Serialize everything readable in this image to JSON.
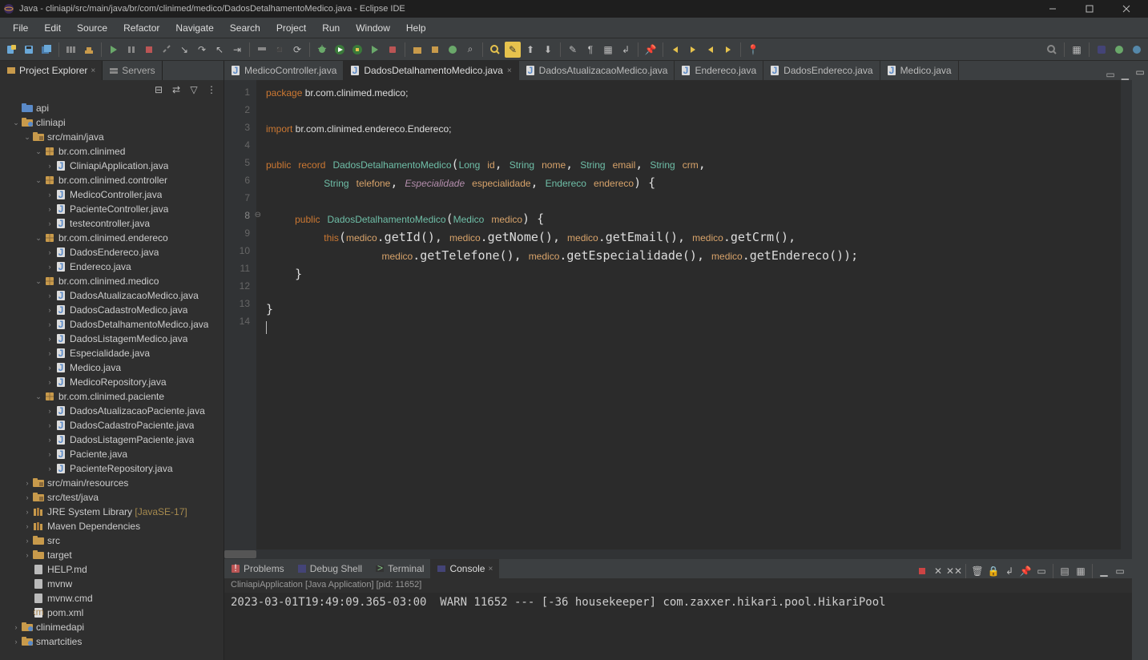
{
  "window": {
    "title": "Java - cliniapi/src/main/java/br/com/clinimed/medico/DadosDetalhamentoMedico.java - Eclipse IDE"
  },
  "menu": [
    "File",
    "Edit",
    "Source",
    "Refactor",
    "Navigate",
    "Search",
    "Project",
    "Run",
    "Window",
    "Help"
  ],
  "views": {
    "projectExplorer": "Project Explorer",
    "servers": "Servers"
  },
  "tree": [
    {
      "d": 1,
      "a": "",
      "i": "folder-blue",
      "t": "api"
    },
    {
      "d": 1,
      "a": "v",
      "i": "project",
      "t": "cliniapi"
    },
    {
      "d": 2,
      "a": "v",
      "i": "pkgfolder",
      "t": "src/main/java"
    },
    {
      "d": 3,
      "a": "v",
      "i": "package",
      "t": "br.com.clinimed"
    },
    {
      "d": 4,
      "a": ">",
      "i": "java",
      "t": "CliniapiApplication.java"
    },
    {
      "d": 3,
      "a": "v",
      "i": "package",
      "t": "br.com.clinimed.controller"
    },
    {
      "d": 4,
      "a": ">",
      "i": "java",
      "t": "MedicoController.java"
    },
    {
      "d": 4,
      "a": ">",
      "i": "java",
      "t": "PacienteController.java"
    },
    {
      "d": 4,
      "a": ">",
      "i": "java",
      "t": "testecontroller.java"
    },
    {
      "d": 3,
      "a": "v",
      "i": "package",
      "t": "br.com.clinimed.endereco"
    },
    {
      "d": 4,
      "a": ">",
      "i": "java",
      "t": "DadosEndereco.java"
    },
    {
      "d": 4,
      "a": ">",
      "i": "java",
      "t": "Endereco.java"
    },
    {
      "d": 3,
      "a": "v",
      "i": "package",
      "t": "br.com.clinimed.medico"
    },
    {
      "d": 4,
      "a": ">",
      "i": "java",
      "t": "DadosAtualizacaoMedico.java"
    },
    {
      "d": 4,
      "a": ">",
      "i": "java",
      "t": "DadosCadastroMedico.java"
    },
    {
      "d": 4,
      "a": ">",
      "i": "java",
      "t": "DadosDetalhamentoMedico.java"
    },
    {
      "d": 4,
      "a": ">",
      "i": "java",
      "t": "DadosListagemMedico.java"
    },
    {
      "d": 4,
      "a": ">",
      "i": "java",
      "t": "Especialidade.java"
    },
    {
      "d": 4,
      "a": ">",
      "i": "java",
      "t": "Medico.java"
    },
    {
      "d": 4,
      "a": ">",
      "i": "java",
      "t": "MedicoRepository.java"
    },
    {
      "d": 3,
      "a": "v",
      "i": "package",
      "t": "br.com.clinimed.paciente"
    },
    {
      "d": 4,
      "a": ">",
      "i": "java",
      "t": "DadosAtualizacaoPaciente.java"
    },
    {
      "d": 4,
      "a": ">",
      "i": "java",
      "t": "DadosCadastroPaciente.java"
    },
    {
      "d": 4,
      "a": ">",
      "i": "java",
      "t": "DadosListagemPaciente.java"
    },
    {
      "d": 4,
      "a": ">",
      "i": "java",
      "t": "Paciente.java"
    },
    {
      "d": 4,
      "a": ">",
      "i": "java",
      "t": "PacienteRepository.java"
    },
    {
      "d": 2,
      "a": ">",
      "i": "pkgfolder",
      "t": "src/main/resources"
    },
    {
      "d": 2,
      "a": ">",
      "i": "pkgfolder",
      "t": "src/test/java"
    },
    {
      "d": 2,
      "a": ">",
      "i": "library",
      "t": "JRE System Library",
      "decor": "[JavaSE-17]"
    },
    {
      "d": 2,
      "a": ">",
      "i": "library",
      "t": "Maven Dependencies"
    },
    {
      "d": 2,
      "a": ">",
      "i": "folder",
      "t": "src"
    },
    {
      "d": 2,
      "a": ">",
      "i": "folder",
      "t": "target"
    },
    {
      "d": 2,
      "a": "",
      "i": "file",
      "t": "HELP.md"
    },
    {
      "d": 2,
      "a": "",
      "i": "file",
      "t": "mvnw"
    },
    {
      "d": 2,
      "a": "",
      "i": "file",
      "t": "mvnw.cmd"
    },
    {
      "d": 2,
      "a": "",
      "i": "xml",
      "t": "pom.xml"
    },
    {
      "d": 1,
      "a": ">",
      "i": "project",
      "t": "clinimedapi"
    },
    {
      "d": 1,
      "a": ">",
      "i": "project",
      "t": "smartcities"
    }
  ],
  "editorTabs": [
    {
      "label": "MedicoController.java",
      "active": false,
      "icon": "java"
    },
    {
      "label": "DadosDetalhamentoMedico.java",
      "active": true,
      "icon": "java"
    },
    {
      "label": "DadosAtualizacaoMedico.java",
      "active": false,
      "icon": "java"
    },
    {
      "label": "Endereco.java",
      "active": false,
      "icon": "java"
    },
    {
      "label": "DadosEndereco.java",
      "active": false,
      "icon": "java"
    },
    {
      "label": "Medico.java",
      "active": false,
      "icon": "java"
    }
  ],
  "code": {
    "lines": 14,
    "l1a": "package",
    "l1b": " br.com.clinimed.medico;",
    "l3a": "import",
    "l3b": " br.com.clinimed.endereco.Endereco;",
    "l5a": "public",
    "l5b": "record",
    "l5c": "DadosDetalhamentoMedico",
    "l5d": "Long",
    "l5e": "id",
    "l5f": "String",
    "l5g": "nome",
    "l5h": "String",
    "l5i": "email",
    "l5j": "String",
    "l5k": "crm",
    "l6a": "String",
    "l6b": "telefone",
    "l6c": "Especialidade",
    "l6d": "especialidade",
    "l6e": "Endereco",
    "l6f": "endereco",
    "l8a": "public",
    "l8b": "DadosDetalhamentoMedico",
    "l8c": "Medico",
    "l8d": "medico",
    "l9a": "this",
    "l9b": "medico",
    "l9c": ".getId(), ",
    "l9d": "medico",
    "l9e": ".getNome(), ",
    "l9f": "medico",
    "l9g": ".getEmail(), ",
    "l9h": "medico",
    "l9i": ".getCrm(),",
    "l10a": "medico",
    "l10b": ".getTelefone(), ",
    "l10c": "medico",
    "l10d": ".getEspecialidade(), ",
    "l10e": "medico",
    "l10f": ".getEndereco());"
  },
  "bottom": {
    "tabs": [
      "Problems",
      "Debug Shell",
      "Terminal",
      "Console"
    ],
    "activeIndex": 3,
    "meta": "CliniapiApplication [Java Application]  [pid: 11652]",
    "out": "2023-03-01T19:49:09.365-03:00  WARN 11652 --- [-36 housekeeper] com.zaxxer.hikari.pool.HikariPool"
  }
}
